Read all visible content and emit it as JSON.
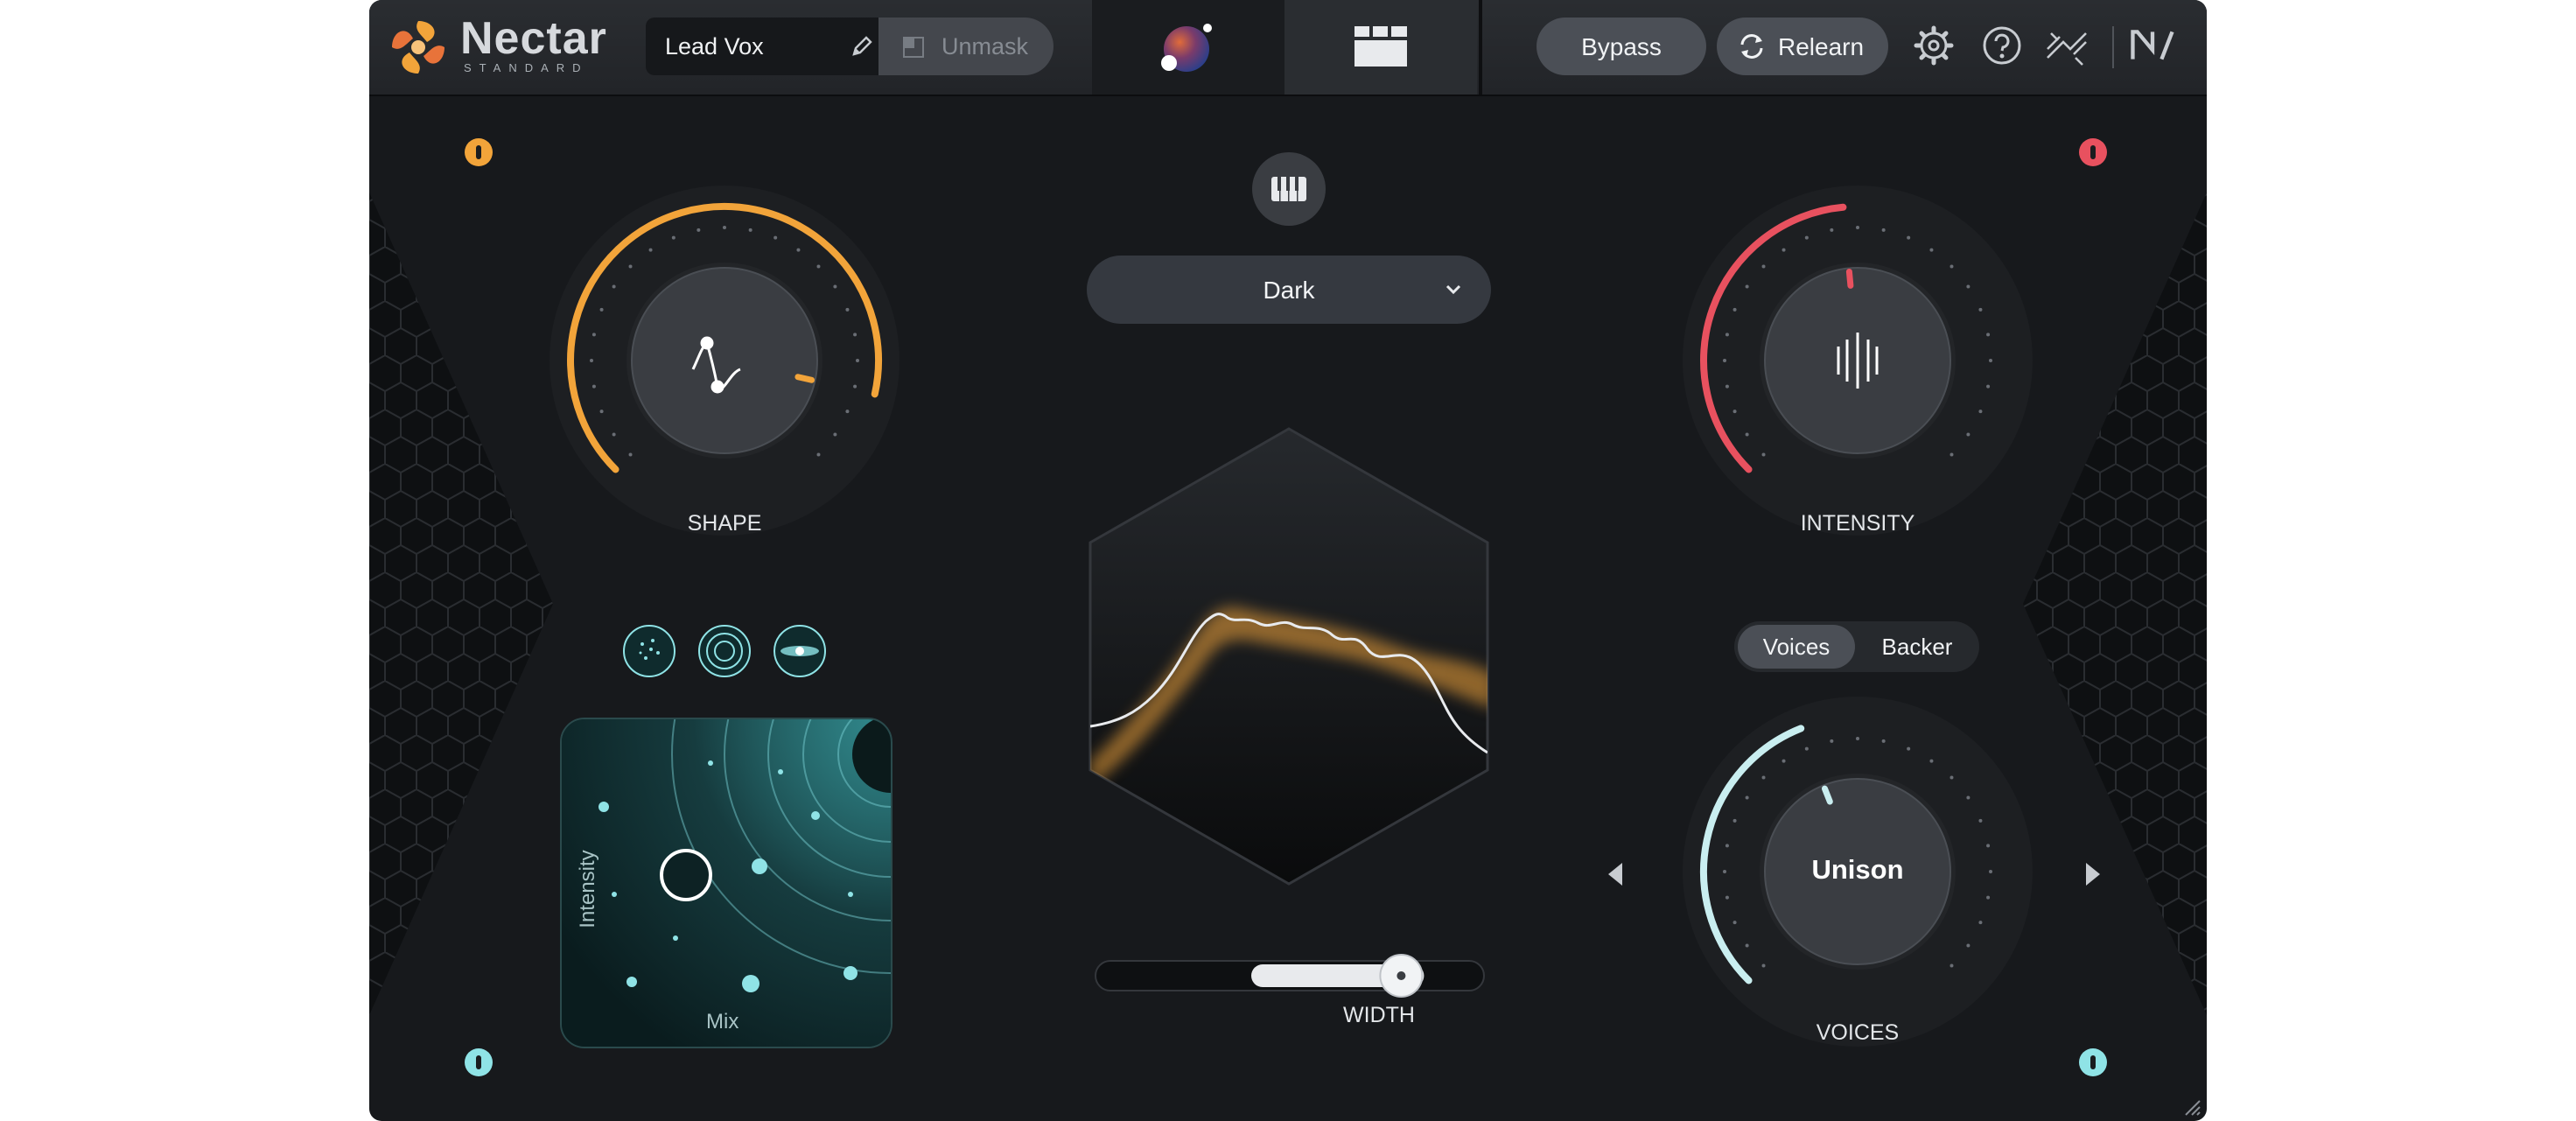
{
  "plugin": {
    "brand": "Nectar",
    "edition": "STANDARD",
    "preset_name": "Lead Vox",
    "unmask_label": "Unmask",
    "bypass_label": "Bypass",
    "relearn_label": "Relearn"
  },
  "knobs": {
    "shape": {
      "label": "SHAPE",
      "value": 0.88
    },
    "intensity": {
      "label": "INTENSITY",
      "value": 0.48
    },
    "voices": {
      "label": "VOICES",
      "center": "Unison",
      "value": 0.42
    }
  },
  "style_dropdown": {
    "selected": "Dark"
  },
  "voices_toggle": {
    "options": [
      "Voices",
      "Backer"
    ],
    "selected": "Voices"
  },
  "xy_pad": {
    "x_label": "Mix",
    "y_label": "Intensity"
  },
  "width": {
    "label": "WIDTH",
    "value": 0.7
  },
  "colors": {
    "accent_orange": "#f2a43a",
    "accent_red": "#e8515f",
    "accent_teal": "#8fe3e6",
    "background": "#17191c"
  },
  "icons": [
    "nectar-logo-icon",
    "pencil-icon",
    "unmask-icon",
    "orb-icon",
    "modules-icon",
    "relearn-icon",
    "gear-icon",
    "help-icon",
    "signal-flow-icon",
    "ni-logo-icon",
    "piano-icon",
    "chevron-down-icon",
    "arrow-left-icon",
    "arrow-right-icon",
    "resize-icon"
  ]
}
